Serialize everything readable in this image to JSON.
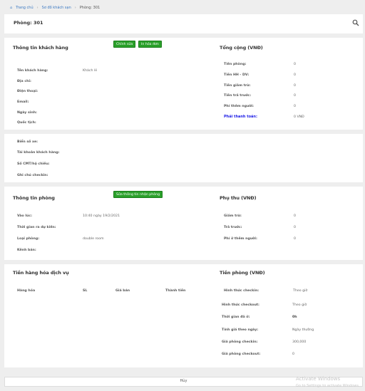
{
  "breadcrumb": {
    "home": "Trang chủ",
    "map": "Sơ đồ khách sạn",
    "current": "Phòng: 301"
  },
  "header": {
    "title": "Phòng: 301"
  },
  "customer": {
    "title": "Thông tin khách hàng",
    "edit_button": "Chỉnh sửa",
    "print_button": "In hóa đơn",
    "rows": [
      {
        "label": "Tên khách hàng:",
        "value": "Khách lẻ"
      },
      {
        "label": "Địa chỉ:",
        "value": ""
      },
      {
        "label": "Điện thoại:",
        "value": ""
      },
      {
        "label": "Email:",
        "value": ""
      },
      {
        "label": "Ngày sinh:",
        "value": ""
      },
      {
        "label": "Quốc tịch:",
        "value": ""
      },
      {
        "label": "Biển số xe:",
        "value": ""
      },
      {
        "label": "Tài khoản khách hàng:",
        "value": ""
      },
      {
        "label": "Số CMT/hộ chiếu:",
        "value": ""
      },
      {
        "label": "Ghi chú checkin:",
        "value": ""
      }
    ]
  },
  "total": {
    "title": "Tổng cộng (VNĐ)",
    "rows": [
      {
        "label": "Tiền phòng:",
        "value": "0"
      },
      {
        "label": "Tiền HH - DV:",
        "value": "0"
      },
      {
        "label": "Tiền giảm trừ:",
        "value": "0"
      },
      {
        "label": "Tiền trả trước:",
        "value": "0"
      },
      {
        "label": "Phí thêm người:",
        "value": "0"
      }
    ],
    "pay_label": "Phải thanh toán:",
    "pay_value": "0 VNĐ"
  },
  "room": {
    "title": "Thông tin phòng",
    "edit_button": "Sửa thông tin nhận phòng",
    "rows": [
      {
        "label": "Vào lúc:",
        "value": "10:40 ngày 19/2/2021"
      },
      {
        "label": "Thời gian ra dự kiến:",
        "value": ""
      },
      {
        "label": "Loại phòng:",
        "value": "double room"
      },
      {
        "label": "Kênh bán:",
        "value": ""
      }
    ]
  },
  "surcharge": {
    "title": "Phụ thu (VNĐ)",
    "rows": [
      {
        "label": "Giảm trừ:",
        "value": "0"
      },
      {
        "label": "Trả trước:",
        "value": "0"
      },
      {
        "label": "Phí ở thêm người:",
        "value": "0"
      }
    ]
  },
  "goods": {
    "title": "Tiền hàng hóa dịch vụ",
    "columns": [
      "Hàng hóa",
      "SL",
      "Giá bán",
      "Thành tiền"
    ]
  },
  "room_price": {
    "title": "Tiền phòng (VNĐ)",
    "rows": [
      {
        "label": "Hình thức checkin:",
        "value": "Theo giờ"
      },
      {
        "label": "Hình thức checkout:",
        "value": "Theo giờ"
      },
      {
        "label": "Thời gian đã ở:",
        "value": "0h"
      },
      {
        "label": "Tính giá theo ngày:",
        "value": "Ngày thường"
      },
      {
        "label": "Giá phòng checkin:",
        "value": "300,000"
      },
      {
        "label": "Giá phòng checkout:",
        "value": "0"
      }
    ]
  },
  "footer": {
    "cancel": "Hủy"
  },
  "watermark": {
    "line1": "Activate Windows",
    "line2": "Go to Settings to activate Windows."
  }
}
